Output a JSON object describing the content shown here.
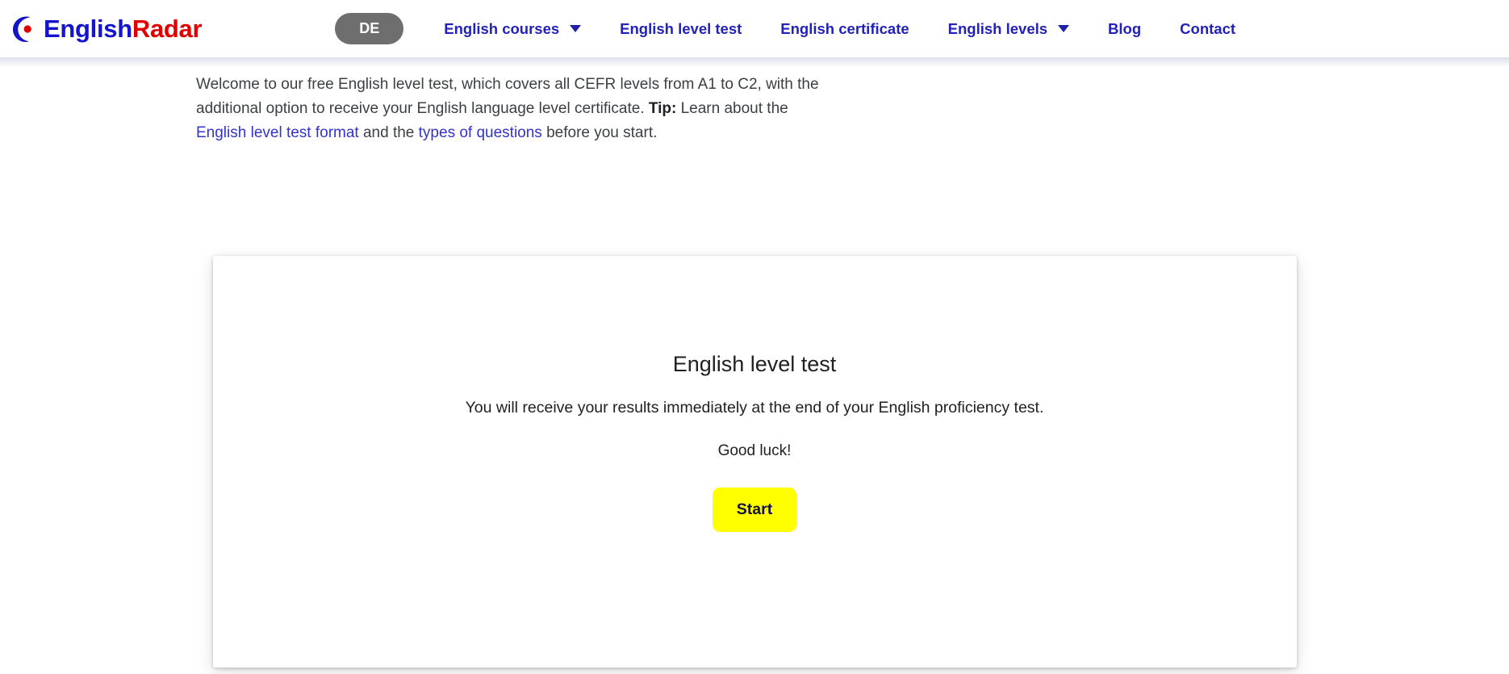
{
  "header": {
    "logo": {
      "icon": "crescent-moon-dot-logo",
      "text_primary": "English",
      "text_secondary": "Radar",
      "color_primary": "#1414cc",
      "color_secondary": "#e00000"
    },
    "language_pill": {
      "label": "DE",
      "background": "#6e6e6e",
      "text_color": "#ffffff"
    },
    "nav_items": [
      {
        "label": "English courses",
        "has_dropdown": true
      },
      {
        "label": "English level test",
        "has_dropdown": false
      },
      {
        "label": "English certificate",
        "has_dropdown": false
      },
      {
        "label": "English levels",
        "has_dropdown": true
      },
      {
        "label": "Blog",
        "has_dropdown": false
      },
      {
        "label": "Contact",
        "has_dropdown": false
      }
    ],
    "nav_link_color": "#2222bb"
  },
  "intro": {
    "segment_1": "Welcome to our free English level test, which covers all CEFR levels from A1 to C2, with the additional option to receive your English language level certificate. ",
    "tip_label": "Tip:",
    "segment_2": " Learn about the ",
    "link_1": "English level test format",
    "segment_3": " and the ",
    "link_2": "types of questions",
    "segment_4": " before you start.",
    "link_color": "#3333cc"
  },
  "card": {
    "title": "English level test",
    "lead": "You will receive your results immediately at the end of your English proficiency test.",
    "luck": "Good luck!",
    "start_button": {
      "label": "Start",
      "background": "#ffff00",
      "text_color": "#12123a"
    }
  }
}
